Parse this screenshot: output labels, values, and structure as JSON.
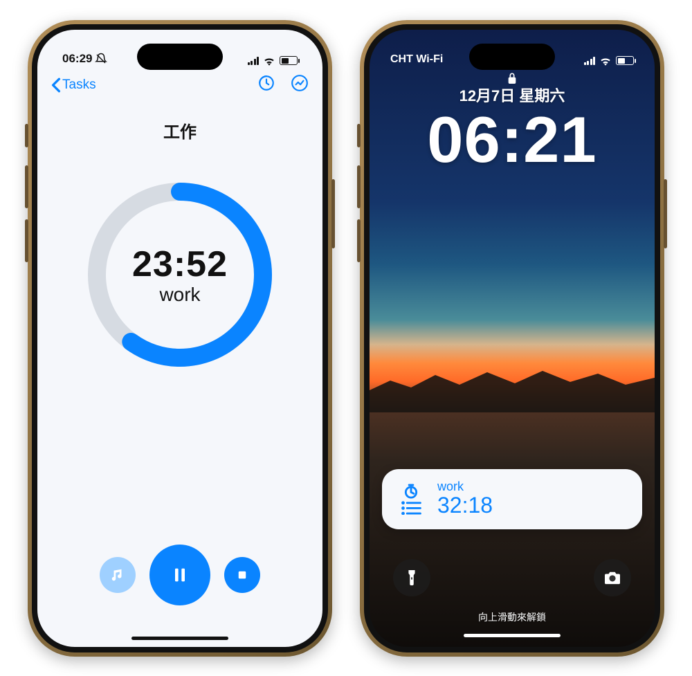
{
  "left": {
    "status": {
      "time": "06:29"
    },
    "nav": {
      "back_label": "Tasks"
    },
    "task_title": "工作",
    "timer": {
      "time": "23:52",
      "mode": "work",
      "progress_pct": 60
    },
    "controls": {
      "music": "music",
      "pause": "pause",
      "stop": "stop"
    },
    "colors": {
      "accent": "#0a84ff",
      "track": "#d6dbe2"
    }
  },
  "right": {
    "status": {
      "carrier": "CHT Wi-Fi"
    },
    "lock": {
      "date": "12月7日 星期六",
      "time": "06:21",
      "unlock_hint": "向上滑動來解鎖"
    },
    "widget": {
      "label": "work",
      "time": "32:18"
    }
  }
}
